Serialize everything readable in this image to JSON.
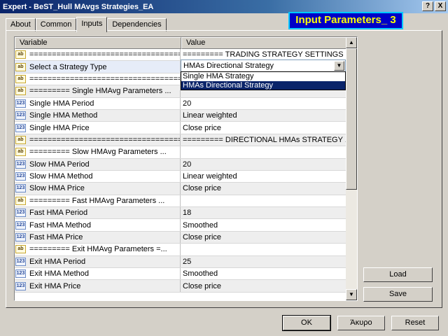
{
  "window": {
    "title": "Expert - BeST_Hull MAvgs Strategies_EA",
    "help_label": "?",
    "close_label": "X"
  },
  "tabs": [
    {
      "label": "About"
    },
    {
      "label": "Common"
    },
    {
      "label": "Inputs"
    },
    {
      "label": "Dependencies"
    }
  ],
  "badge": "Input Parameters_ 3",
  "columns": {
    "variable": "Variable",
    "value": "Value"
  },
  "rows": [
    {
      "type": "ab",
      "variable": "=====================================...",
      "value": "========= TRADING STRATEGY SETTINGS ..."
    },
    {
      "type": "ab",
      "variable": "Select a Strategy Type",
      "value": ""
    },
    {
      "type": "ab",
      "variable": "=====================================...",
      "value": ""
    },
    {
      "type": "ab",
      "variable": "========= Single HMAvg Parameters ...",
      "value": ""
    },
    {
      "type": "123",
      "variable": "Single HMA Period",
      "value": "20"
    },
    {
      "type": "123",
      "variable": "Single HMA Method",
      "value": "Linear weighted"
    },
    {
      "type": "123",
      "variable": "Single HMA Price",
      "value": "Close price"
    },
    {
      "type": "ab",
      "variable": "=====================================...",
      "value": "========= DIRECTIONAL HMAs STRATEGY ..."
    },
    {
      "type": "ab",
      "variable": "========= Slow HMAvg Parameters ...",
      "value": ""
    },
    {
      "type": "123",
      "variable": "Slow HMA Period",
      "value": "20"
    },
    {
      "type": "123",
      "variable": "Slow HMA Method",
      "value": "Linear weighted"
    },
    {
      "type": "123",
      "variable": "Slow HMA Price",
      "value": "Close price"
    },
    {
      "type": "ab",
      "variable": "========= Fast HMAvg Parameters ...",
      "value": ""
    },
    {
      "type": "123",
      "variable": "Fast HMA Period",
      "value": "18"
    },
    {
      "type": "123",
      "variable": "Fast HMA Method",
      "value": "Smoothed"
    },
    {
      "type": "123",
      "variable": "Fast HMA Price",
      "value": "Close price"
    },
    {
      "type": "ab",
      "variable": "========= Exit HMAvg Parameters =...",
      "value": ""
    },
    {
      "type": "123",
      "variable": "Exit HMA Period",
      "value": "25"
    },
    {
      "type": "123",
      "variable": "Exit HMA Method",
      "value": "Smoothed"
    },
    {
      "type": "123",
      "variable": "Exit HMA Price",
      "value": "Close price"
    }
  ],
  "icon_labels": {
    "ab": "ab",
    "num": "123"
  },
  "combo": {
    "selected": "HMAs Directional Strategy"
  },
  "dropdown": {
    "options": [
      "Single HMA Strategy",
      "HMAs Directional Strategy"
    ]
  },
  "buttons": {
    "load": "Load",
    "save": "Save",
    "ok": "OK",
    "cancel": "Άκυρο",
    "reset": "Reset"
  },
  "colors": {
    "badge_bg": "#0000c8",
    "badge_text": "#ffff00",
    "selection": "#0a246a"
  }
}
